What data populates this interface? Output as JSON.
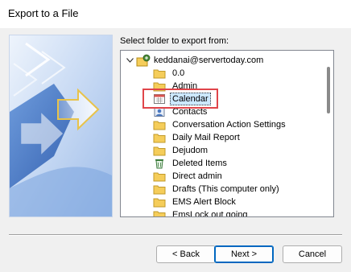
{
  "window": {
    "title": "Export to a File"
  },
  "section": {
    "label": "Select folder to export from:"
  },
  "tree": {
    "root": {
      "label": "keddanai@servertoday.com",
      "icon": "mailbox-icon",
      "expanded": true
    },
    "items": [
      {
        "label": "0.0",
        "icon": "folder-icon"
      },
      {
        "label": "Admin",
        "icon": "folder-icon"
      },
      {
        "label": "Calendar",
        "icon": "calendar-icon",
        "selected": true
      },
      {
        "label": "Contacts",
        "icon": "contacts-icon"
      },
      {
        "label": "Conversation Action Settings",
        "icon": "folder-icon"
      },
      {
        "label": "Daily Mail Report",
        "icon": "folder-icon"
      },
      {
        "label": "Dejudom",
        "icon": "folder-icon"
      },
      {
        "label": "Deleted Items",
        "icon": "trash-icon"
      },
      {
        "label": "Direct admin",
        "icon": "folder-icon"
      },
      {
        "label": "Drafts (This computer only)",
        "icon": "folder-icon"
      },
      {
        "label": "EMS Alert Block",
        "icon": "folder-icon"
      },
      {
        "label": "EmsLock out going",
        "icon": "folder-icon"
      }
    ]
  },
  "buttons": {
    "back": "< Back",
    "next": "Next >",
    "cancel": "Cancel"
  },
  "colors": {
    "selection_bg": "#cce8ff",
    "highlight_border": "#e0454a",
    "folder": "#f5cd5a",
    "default_button_border": "#0067c0"
  }
}
